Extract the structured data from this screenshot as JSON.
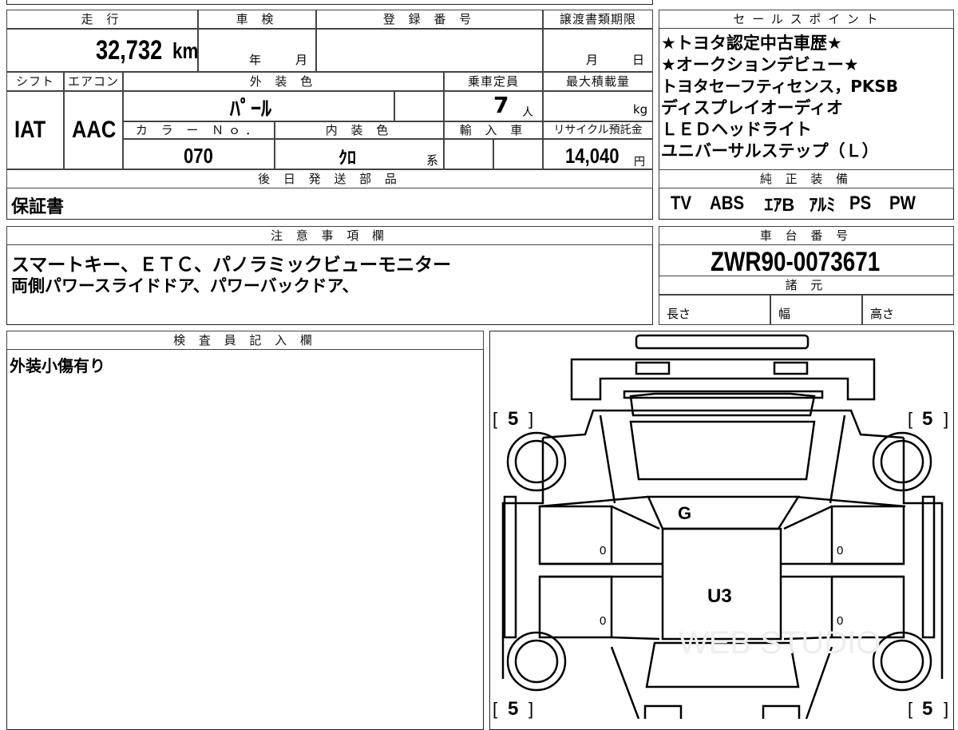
{
  "mileage": {
    "header": "走 行",
    "value": "32,732",
    "unit": "km"
  },
  "inspection": {
    "header": "車 検",
    "year_unit": "年",
    "month_unit": "月"
  },
  "registration": {
    "header": "登 録 番 号"
  },
  "transfer_deadline": {
    "header": "譲渡書類期限",
    "month_unit": "月",
    "day_unit": "日"
  },
  "shift": {
    "header": "シフト",
    "value": "IAT"
  },
  "aircon": {
    "header": "エアコン",
    "value": "AAC"
  },
  "exterior_color": {
    "header": "外 装 色",
    "value": "ﾊﾟｰﾙ"
  },
  "capacity": {
    "header": "乗車定員",
    "value": "7",
    "unit": "人"
  },
  "max_load": {
    "header": "最大積載量",
    "unit": "kg"
  },
  "color_no": {
    "header": "カ ラ ー Ｎｏ．",
    "value": "070"
  },
  "interior_color": {
    "header": "内 装 色",
    "value": "ｸﾛ",
    "suffix": "系"
  },
  "import": {
    "header": "輸 入 車"
  },
  "recycle": {
    "header": "リサイクル預託金",
    "value": "14,040",
    "unit": "円"
  },
  "later_parts": {
    "header": "後 日 発 送 部 品",
    "value": "保証書"
  },
  "sales_points": {
    "header": "セ ー ル ス ポ イ ン ト",
    "lines": [
      "★トヨタ認定中古車歴★",
      "★オークションデビュー★",
      "トヨタセーフティセンス，PKSB",
      "ディスプレイオーディオ",
      "ＬＥＤヘッドライト",
      "ユニバーサルステップ（Ｌ）"
    ]
  },
  "genuine_equipment": {
    "header": "純 正 装 備",
    "items": [
      "TV",
      "ABS",
      "ｴｱB",
      "ｱﾙﾐ",
      "PS",
      "PW"
    ]
  },
  "notes": {
    "header": "注 意 事 項 欄",
    "lines": [
      "スマートキー、ＥＴＣ、パノラミックビューモニター",
      "両側パワースライドドア、パワーバックドア、"
    ]
  },
  "chassis": {
    "header": "車 台 番 号",
    "value": "ZWR90-0073671"
  },
  "specs": {
    "header": "諸 元",
    "length": "長さ",
    "width": "幅",
    "height": "高さ"
  },
  "inspector": {
    "header": "検 査 員 記 入 欄",
    "text": "外装小傷有り"
  },
  "diagram": {
    "tire_fl": "5",
    "tire_fr": "5",
    "tire_rl": "5",
    "tire_rr": "5",
    "hood": "G",
    "roof": "U3",
    "door_lf": "0",
    "door_lr": "0",
    "door_rf": "0",
    "door_rr": "0",
    "watermark": "WEB STUDIO"
  }
}
